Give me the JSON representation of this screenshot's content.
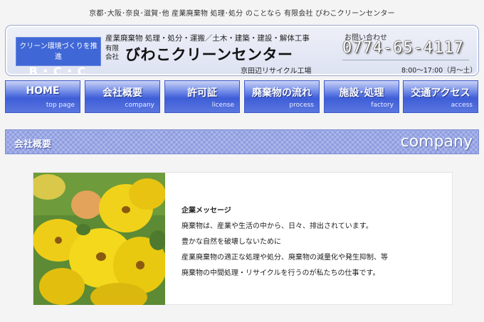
{
  "tagline": "京都･大阪･奈良･滋賀･他 産業廃棄物 処理･処分 のことなら 有限会社 びわこクリーンセンター",
  "header": {
    "badge_line1": "クリーン環境づくりを推進",
    "badge_line2": "B・C・C",
    "description": "産業廃棄物 処理・処分・運搬／土木・建築・建設・解体工事",
    "company_type_line1": "有限",
    "company_type_line2": "会社",
    "company_name": "びわこクリーンセンター",
    "plant": "京田辺リサイクル工場",
    "contact_label": "お問い合わせ",
    "phone": "0774-65-4117",
    "hours": "8:00～17:00（月～土）"
  },
  "nav": [
    {
      "label": "HOME",
      "sub": "top page"
    },
    {
      "label": "会社概要",
      "sub": "company"
    },
    {
      "label": "許可証",
      "sub": "license"
    },
    {
      "label": "廃棄物の流れ",
      "sub": "process"
    },
    {
      "label": "施設･処理",
      "sub": "factory"
    },
    {
      "label": "交通アクセス",
      "sub": "access"
    }
  ],
  "section": {
    "title": "会社概要",
    "sub": "company"
  },
  "content": {
    "photo_icon": "yellow-pansy-flowers",
    "message_title": "企業メッセージ",
    "lines": [
      "廃棄物は、産業や生活の中から、日々、排出されています。",
      "豊かな自然を破壊しないために",
      "産業廃棄物の適正な処理や処分、廃棄物の減量化や発生抑制、等",
      "廃棄物の中間処理・リサイクルを行うのが私たちの仕事です。"
    ]
  },
  "colors": {
    "nav_blue": "#3e5ed8",
    "badge_blue": "#3f67d6",
    "section_bar": "#8c9be0",
    "page_bg": "#f4f4f4"
  }
}
